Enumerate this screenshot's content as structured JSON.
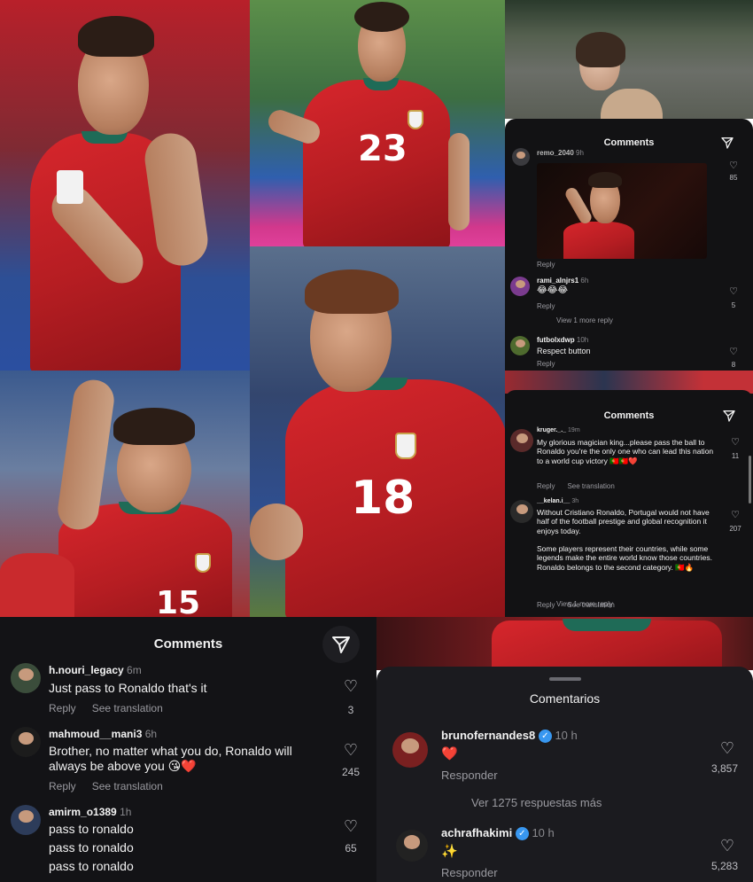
{
  "photos": {
    "p1": {
      "number": ""
    },
    "p2": {
      "number": "23"
    },
    "p4": {
      "number": "18"
    },
    "p5": {
      "number": "15"
    }
  },
  "panel_top": {
    "title": "Comments",
    "comments": [
      {
        "user": "remo_2040",
        "time": "9h",
        "text": "",
        "reply": "Reply",
        "likes": "85"
      },
      {
        "user": "rami_alnjrs1",
        "time": "6h",
        "text": "😂😂😂",
        "reply": "Reply",
        "likes": "5"
      },
      {
        "user": "futbolxdwp",
        "time": "10h",
        "text": "Respect button",
        "reply": "Reply",
        "likes": "8"
      }
    ],
    "view_more": "View 1 more reply"
  },
  "panel_mid": {
    "title": "Comments",
    "comments": [
      {
        "user": "kruger._._",
        "time": "19m",
        "text": "My glorious magician king...please pass the ball to Ronaldo you're the only one who can lead this nation to a world cup victory 🇵🇹🇵🇹❤️",
        "reply": "Reply",
        "translate": "See translation",
        "likes": "11"
      },
      {
        "user": "__kelan.i__",
        "time": "3h",
        "text": "Without Cristiano Ronaldo, Portugal would not have half of the football prestige and global recognition it enjoys today.",
        "text2": "Some players represent their countries, while some legends make the entire world know those countries. Ronaldo belongs to the second category. 🇵🇹🔥",
        "reply": "Reply",
        "translate": "See translation",
        "likes": "207"
      }
    ],
    "view_more": "View 1 more reply"
  },
  "panel_bl": {
    "title": "Comments",
    "comments": [
      {
        "user": "h.nouri_legacy",
        "time": "6m",
        "text": "Just pass  to Ronaldo that's it",
        "reply": "Reply",
        "translate": "See translation",
        "likes": "3"
      },
      {
        "user": "mahmoud__mani3",
        "time": "6h",
        "text": "Brother, no matter what you do, Ronaldo will always be above you 😘❤️",
        "reply": "Reply",
        "translate": "See translation",
        "likes": "245"
      },
      {
        "user": "amirm_o1389",
        "time": "1h",
        "lines": [
          "pass to ronaldo",
          "pass to ronaldo",
          "pass to ronaldo"
        ],
        "likes": "65"
      }
    ]
  },
  "panel_br": {
    "title": "Comentarios",
    "comments": [
      {
        "user": "brunofernandes8",
        "time": "10 h",
        "text": "❤️",
        "reply": "Responder",
        "likes": "3,857"
      },
      {
        "user": "achrafhakimi",
        "time": "10 h",
        "text": "✨",
        "reply": "Responder",
        "likes": "5,283"
      }
    ],
    "view_more": "Ver 1275 respuestas más"
  },
  "icons": [
    "send-icon",
    "heart-icon",
    "verified-icon"
  ],
  "colors": {
    "jersey_red": "#d7262c",
    "panel_bg": "#121214",
    "verified_blue": "#3897f0"
  }
}
